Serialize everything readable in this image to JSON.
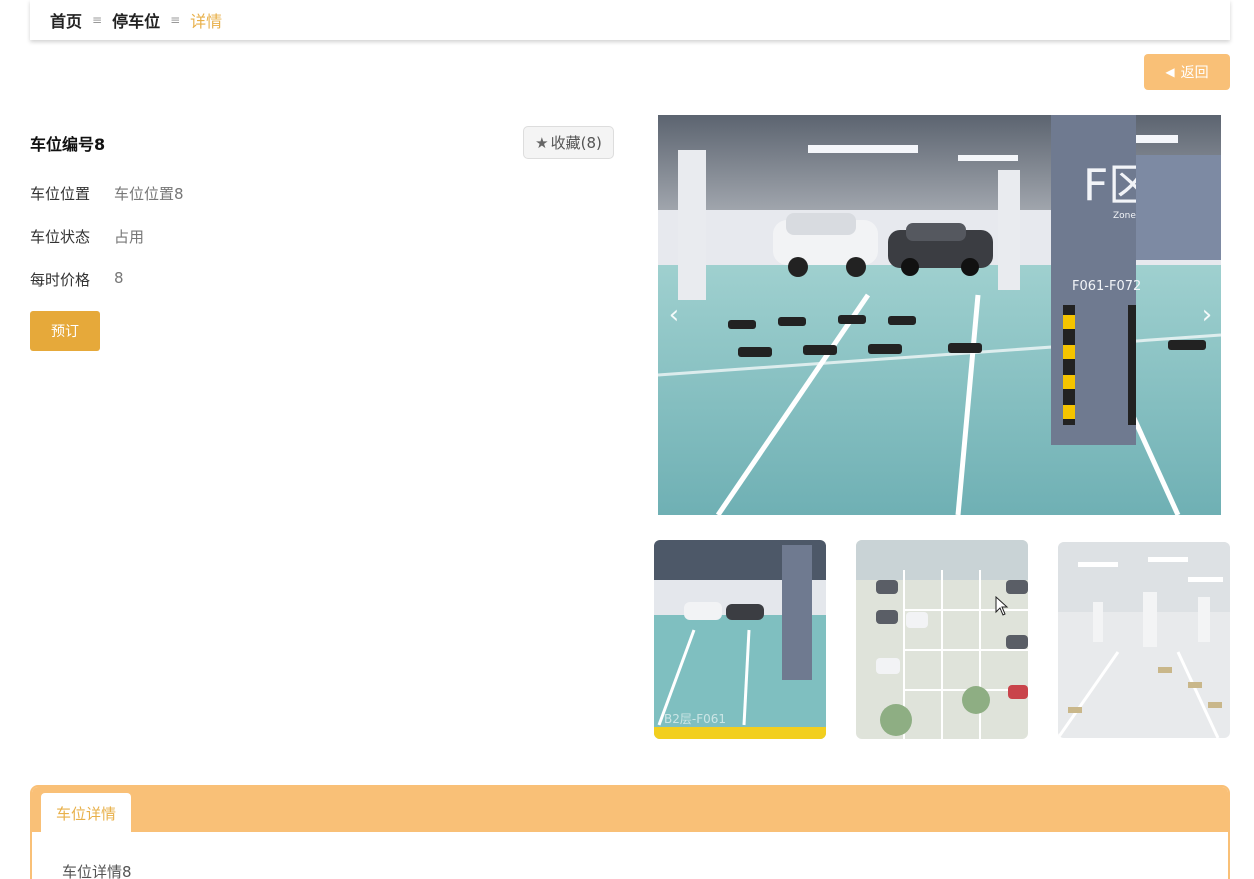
{
  "breadcrumb": {
    "home": "首页",
    "section": "停车位",
    "current": "详情",
    "separator": "≡"
  },
  "back_button": {
    "label": "返回"
  },
  "spot": {
    "title": "车位编号8",
    "favorite_label": "收藏(8)",
    "fields": [
      {
        "label": "车位位置",
        "value": "车位位置8"
      },
      {
        "label": "车位状态",
        "value": "占用"
      },
      {
        "label": "每时价格",
        "value": "8"
      }
    ],
    "book_label": "预订"
  },
  "gallery": {
    "main_sign_text": "F区",
    "main_sign_small": "Zone",
    "main_sign_range": "F061-F072",
    "thumb1_caption": "B2层-F061"
  },
  "detail_panel": {
    "tab_label": "车位详情",
    "content": "车位详情8"
  },
  "colors": {
    "accent": "#f9c077",
    "accent_dark": "#e6a93a",
    "accent_text": "#e8b04a"
  }
}
